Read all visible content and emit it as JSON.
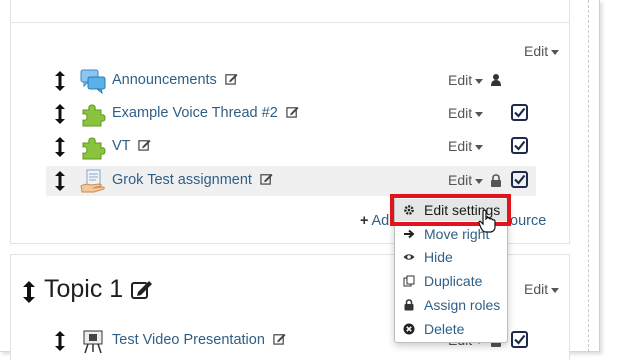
{
  "section": {
    "edit_label": "Edit",
    "activities": [
      {
        "name": "Announcements",
        "icon": "forum-icon",
        "edit_label": "Edit",
        "right_icon": "user-icon"
      },
      {
        "name": "Example Voice Thread #2",
        "icon": "puzzle-icon",
        "edit_label": "Edit",
        "right_icon": "checkbox-icon"
      },
      {
        "name": "VT",
        "icon": "puzzle-icon",
        "edit_label": "Edit",
        "right_icon": "checkbox-icon"
      },
      {
        "name": "Grok Test assignment",
        "icon": "assignment-hand-icon",
        "edit_label": "Edit",
        "right_icon": "checkbox-icon"
      }
    ],
    "add_label_start": "Ad",
    "add_label_end": "ource"
  },
  "menu": {
    "items": [
      {
        "label": "Edit settings",
        "icon": "gear-icon"
      },
      {
        "label": "Move right",
        "icon": "arrow-right-icon"
      },
      {
        "label": "Hide",
        "icon": "eye-icon"
      },
      {
        "label": "Duplicate",
        "icon": "copy-icon"
      },
      {
        "label": "Assign roles",
        "icon": "lock-icon"
      },
      {
        "label": "Delete",
        "icon": "delete-icon"
      }
    ]
  },
  "topic": {
    "title": "Topic 1",
    "edit_label": "Edit",
    "activity": {
      "name": "Test Video Presentation",
      "edit_label": "Edit",
      "icon": "video-easel-icon"
    }
  },
  "colors": {
    "link": "#2f5f86",
    "highlight_ring": "#e0141d",
    "row_highlight": "#f0f0f0"
  }
}
